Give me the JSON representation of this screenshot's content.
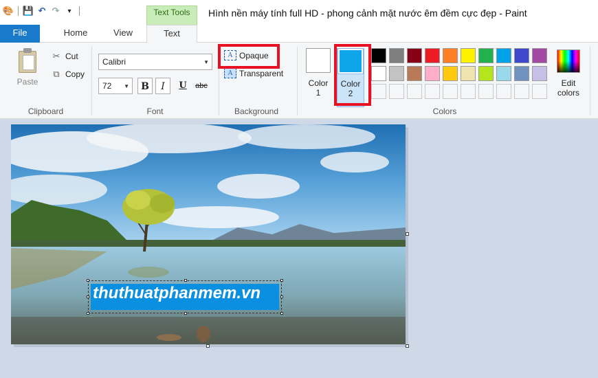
{
  "window": {
    "title": "Hình nền máy tính full HD - phong cảnh mặt nước êm đềm cực đẹp - Paint",
    "context_tab_label": "Text Tools"
  },
  "tabs": {
    "file": "File",
    "home": "Home",
    "view": "View",
    "text": "Text"
  },
  "clipboard": {
    "label": "Clipboard",
    "paste": "Paste",
    "cut": "Cut",
    "copy": "Copy"
  },
  "font": {
    "label": "Font",
    "family": "Calibri",
    "size": "72",
    "bold": "B",
    "italic": "I",
    "underline": "U",
    "strikethrough": "abc"
  },
  "background": {
    "label": "Background",
    "opaque": "Opaque",
    "transparent": "Transparent",
    "selected": "Opaque"
  },
  "colors": {
    "label": "Colors",
    "color1_line1": "Color",
    "color1_line2": "1",
    "color2_line1": "Color",
    "color2_line2": "2",
    "edit_line1": "Edit",
    "edit_line2": "colors",
    "color1_value": "#ffffff",
    "color2_value": "#0ea5e9",
    "palette_row1": [
      "#000000",
      "#7f7f7f",
      "#880015",
      "#ed1c24",
      "#ff7f27",
      "#fff200",
      "#22b14c",
      "#00a2e8",
      "#3f48cc",
      "#a349a4"
    ],
    "palette_row2": [
      "#ffffff",
      "#c3c3c3",
      "#b97a57",
      "#ffaec9",
      "#ffc90e",
      "#efe4b0",
      "#b5e61d",
      "#99d9ea",
      "#7092be",
      "#c8bfe7"
    ]
  },
  "canvas": {
    "text_box": "thuthuatphanmem.vn"
  }
}
